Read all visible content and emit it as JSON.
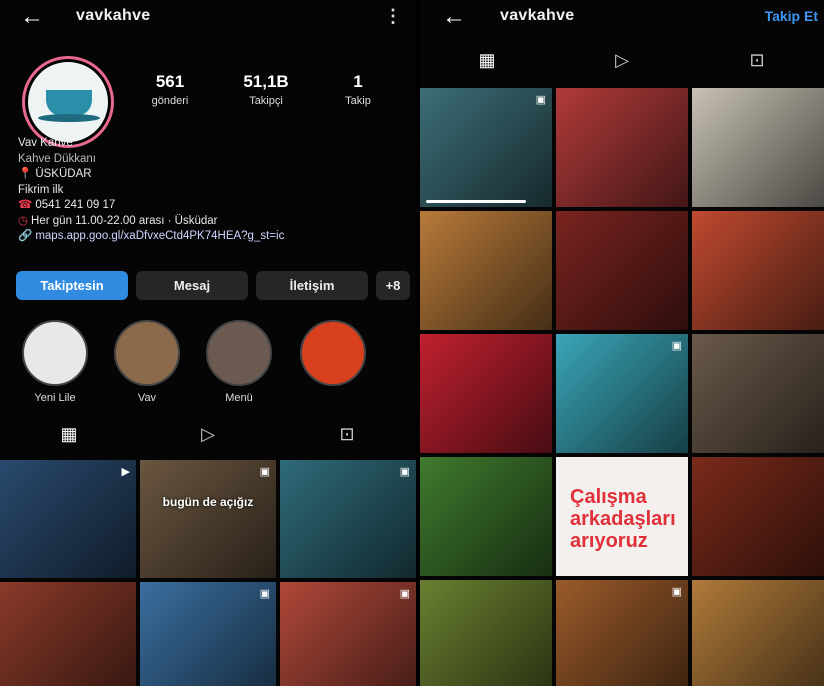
{
  "left": {
    "username": "vavkahve",
    "stats": [
      {
        "value": "561",
        "label": "gönderi"
      },
      {
        "value": "51,1B",
        "label": "Takipçi"
      },
      {
        "value": "1",
        "label": "Takip"
      }
    ],
    "bio": {
      "name": "Vav Kahve",
      "category": "Kahve Dükkanı",
      "location": "ÜSKÜDAR",
      "extra": "Fikrim ilk",
      "phone": "0541 241 09 17",
      "hours": "Her gün 11.00-22.00 arası · Üsküdar",
      "link": "maps.app.goo.gl/xaDfvxeCtd4PK74HEA?g_st=ic"
    },
    "buttons": {
      "following": "Takiptesin",
      "message": "Mesaj",
      "contact": "İletişim",
      "add": "+8"
    },
    "highlights": [
      {
        "label": "Yeni Lile"
      },
      {
        "label": "Vav"
      },
      {
        "label": "Menü"
      },
      {
        "label": ""
      }
    ],
    "tabs": [
      "grid-icon",
      "reels-icon",
      "tagged-icon"
    ],
    "posts": [
      {
        "color": "#2a4a6e",
        "badge": "▶"
      },
      {
        "color": "#6a5640",
        "text": "bugün de açığız",
        "badge": "▣"
      },
      {
        "color": "#2f6b7a",
        "badge": "▣"
      },
      {
        "color": "#8a3a2a",
        "badge": ""
      },
      {
        "color": "#3a6fa0",
        "badge": "▣"
      },
      {
        "color": "#b0483a",
        "badge": "▣"
      }
    ]
  },
  "right": {
    "username": "vavkahve",
    "follow": "Takip Et",
    "tabs": [
      "grid-icon",
      "reels-icon",
      "tagged-icon"
    ],
    "posts": [
      {
        "color": "#3d6e78",
        "badge": "▣",
        "progress": 0.85
      },
      {
        "color": "#b23a3a",
        "badge": ""
      },
      {
        "color": "#c8c2b4",
        "badge": ""
      },
      {
        "color": "#b87a3a",
        "badge": ""
      },
      {
        "color": "#7a2420",
        "badge": ""
      },
      {
        "color": "#c04a30",
        "badge": ""
      },
      {
        "color": "#c02030",
        "badge": ""
      },
      {
        "color": "#3aa6b8",
        "badge": "▣"
      },
      {
        "color": "#6a5a4a",
        "badge": ""
      },
      {
        "color": "#3f7a2e",
        "badge": ""
      },
      {
        "color": "#f4f0ee",
        "text": "Çalışma arkadaşları arıyoruz",
        "poster": true,
        "badge": ""
      },
      {
        "color": "#7a2a1a",
        "badge": ""
      },
      {
        "color": "#6a8030",
        "badge": ""
      },
      {
        "color": "#9a5a2a",
        "badge": "▣"
      },
      {
        "color": "#b07a3a",
        "badge": ""
      }
    ]
  }
}
